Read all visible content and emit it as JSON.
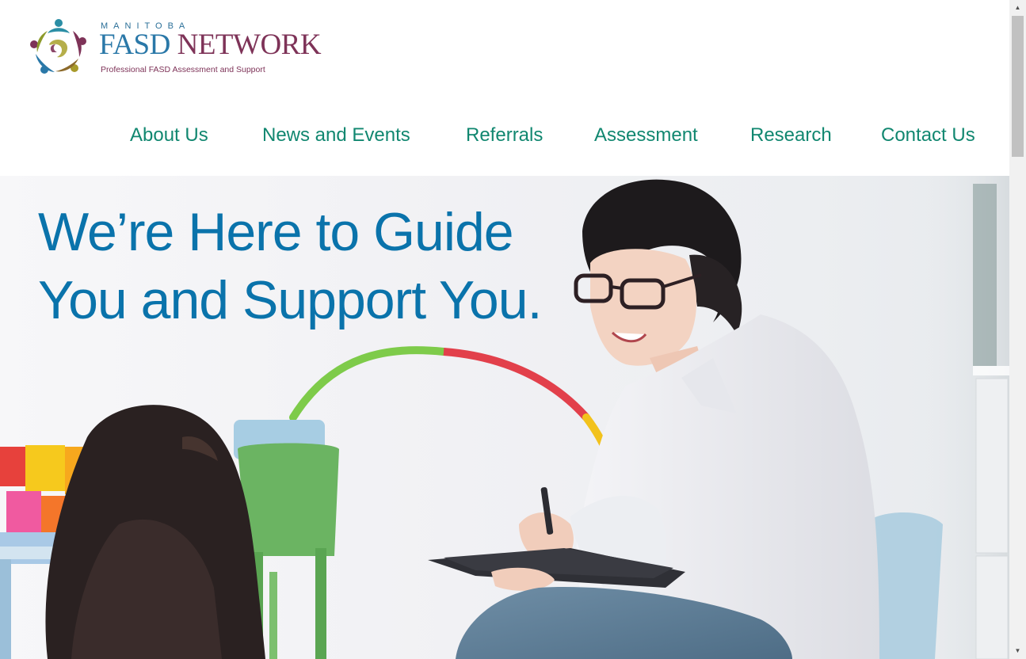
{
  "logo": {
    "small_text": "MANITOBA",
    "name_part1": "FASD",
    "name_part2": "NETWORK",
    "tagline": "Professional FASD Assessment and Support",
    "icon": "people-circle-logo-icon"
  },
  "nav": {
    "items": [
      {
        "label": "About Us"
      },
      {
        "label": "News and Events"
      },
      {
        "label": "Referrals"
      },
      {
        "label": "Assessment"
      },
      {
        "label": "Research"
      },
      {
        "label": "Contact Us"
      }
    ]
  },
  "hero": {
    "headline_line1": "We’re Here to Guide",
    "headline_line2": "You and Support You.",
    "image": "clinician-with-child-photo"
  },
  "scrollbar": {
    "up_icon": "scroll-up-arrow-icon",
    "down_icon": "scroll-down-arrow-icon"
  },
  "colors": {
    "nav_text": "#118770",
    "headline": "#0a73ab",
    "logo_blue": "#2a78a8",
    "logo_purple": "#7e3358"
  }
}
